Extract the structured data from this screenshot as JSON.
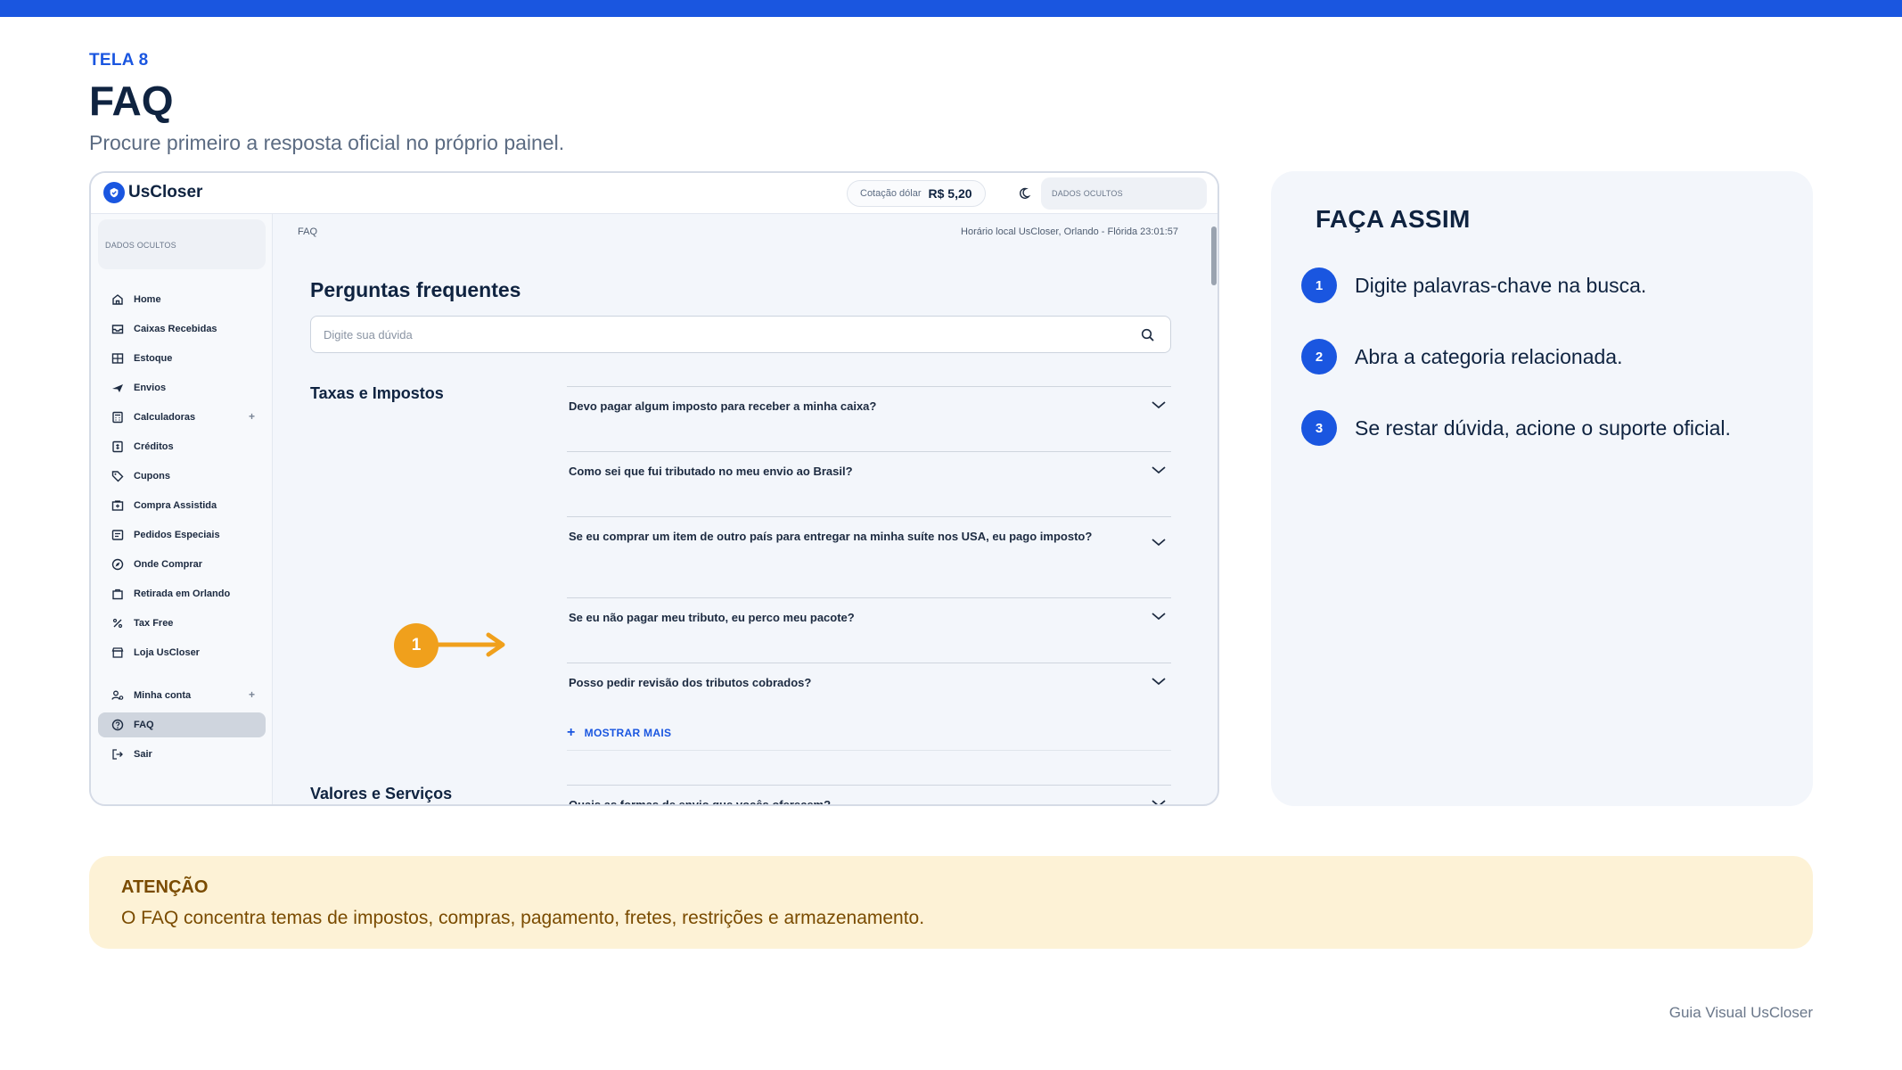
{
  "slide": {
    "label": "TELA 8",
    "title": "FAQ",
    "subtitle": "Procure primeiro a resposta oficial no próprio painel."
  },
  "app": {
    "brand": "UsCloser",
    "quote_label": "Cotação dólar",
    "quote_value": "R$ 5,20",
    "user_hidden": "DADOS OCULTOS",
    "sidebar_user_hidden": "DADOS OCULTOS",
    "sidebar": [
      {
        "label": "Home",
        "icon": "home-icon"
      },
      {
        "label": "Caixas Recebidas",
        "icon": "inbox-icon"
      },
      {
        "label": "Estoque",
        "icon": "warehouse-icon"
      },
      {
        "label": "Envios",
        "icon": "plane-icon"
      },
      {
        "label": "Calculadoras",
        "icon": "calculator-icon",
        "expandable": true
      },
      {
        "label": "Créditos",
        "icon": "credit-icon"
      },
      {
        "label": "Cupons",
        "icon": "tag-icon"
      },
      {
        "label": "Compra Assistida",
        "icon": "assisted-purchase-icon"
      },
      {
        "label": "Pedidos Especiais",
        "icon": "special-order-icon"
      },
      {
        "label": "Onde Comprar",
        "icon": "compass-icon"
      },
      {
        "label": "Retirada em Orlando",
        "icon": "bag-icon"
      },
      {
        "label": "Tax Free",
        "icon": "percent-icon"
      },
      {
        "label": "Loja UsCloser",
        "icon": "store-icon"
      }
    ],
    "sidebar_account": [
      {
        "label": "Minha conta",
        "icon": "account-icon",
        "expandable": true
      },
      {
        "label": "FAQ",
        "icon": "help-icon",
        "active": true
      },
      {
        "label": "Sair",
        "icon": "logout-icon"
      }
    ],
    "breadcrumb": "FAQ",
    "clock": "Horário local UsCloser, Orlando - Flórida 23:01:57",
    "faq_title": "Perguntas frequentes",
    "search_placeholder": "Digite sua dúvida",
    "categories": [
      {
        "title": "Taxas e Impostos",
        "questions": [
          "Devo pagar algum imposto para receber a minha caixa?",
          "Como sei que fui tributado no meu envio ao Brasil?",
          "Se eu comprar um item de outro país para entregar na minha suíte nos USA, eu pago imposto?",
          "Se eu não pagar meu tributo, eu perco meu pacote?",
          "Posso pedir revisão dos tributos cobrados?"
        ],
        "show_more": "MOSTRAR MAIS"
      },
      {
        "title": "Valores e Serviços",
        "questions": [
          "Quais as formas de envio que vocês oferecem?"
        ]
      }
    ]
  },
  "annotation": {
    "marker": "1"
  },
  "steps_panel": {
    "title": "FAÇA ASSIM",
    "steps": [
      {
        "num": "1",
        "text": "Digite palavras-chave na busca."
      },
      {
        "num": "2",
        "text": "Abra a categoria relacionada."
      },
      {
        "num": "3",
        "text": "Se restar dúvida, acione o suporte oficial."
      }
    ]
  },
  "attention": {
    "title": "ATENÇÃO",
    "text": "O FAQ concentra temas de impostos, compras, pagamento, fretes, restrições e armazenamento."
  },
  "footer": "Guia Visual UsCloser",
  "colors": {
    "accent": "#1a56e0",
    "annotation": "#f0a01c",
    "whatsapp": "#28a745",
    "attention_bg": "#fdf2d6",
    "attention_text": "#7a4b00"
  }
}
